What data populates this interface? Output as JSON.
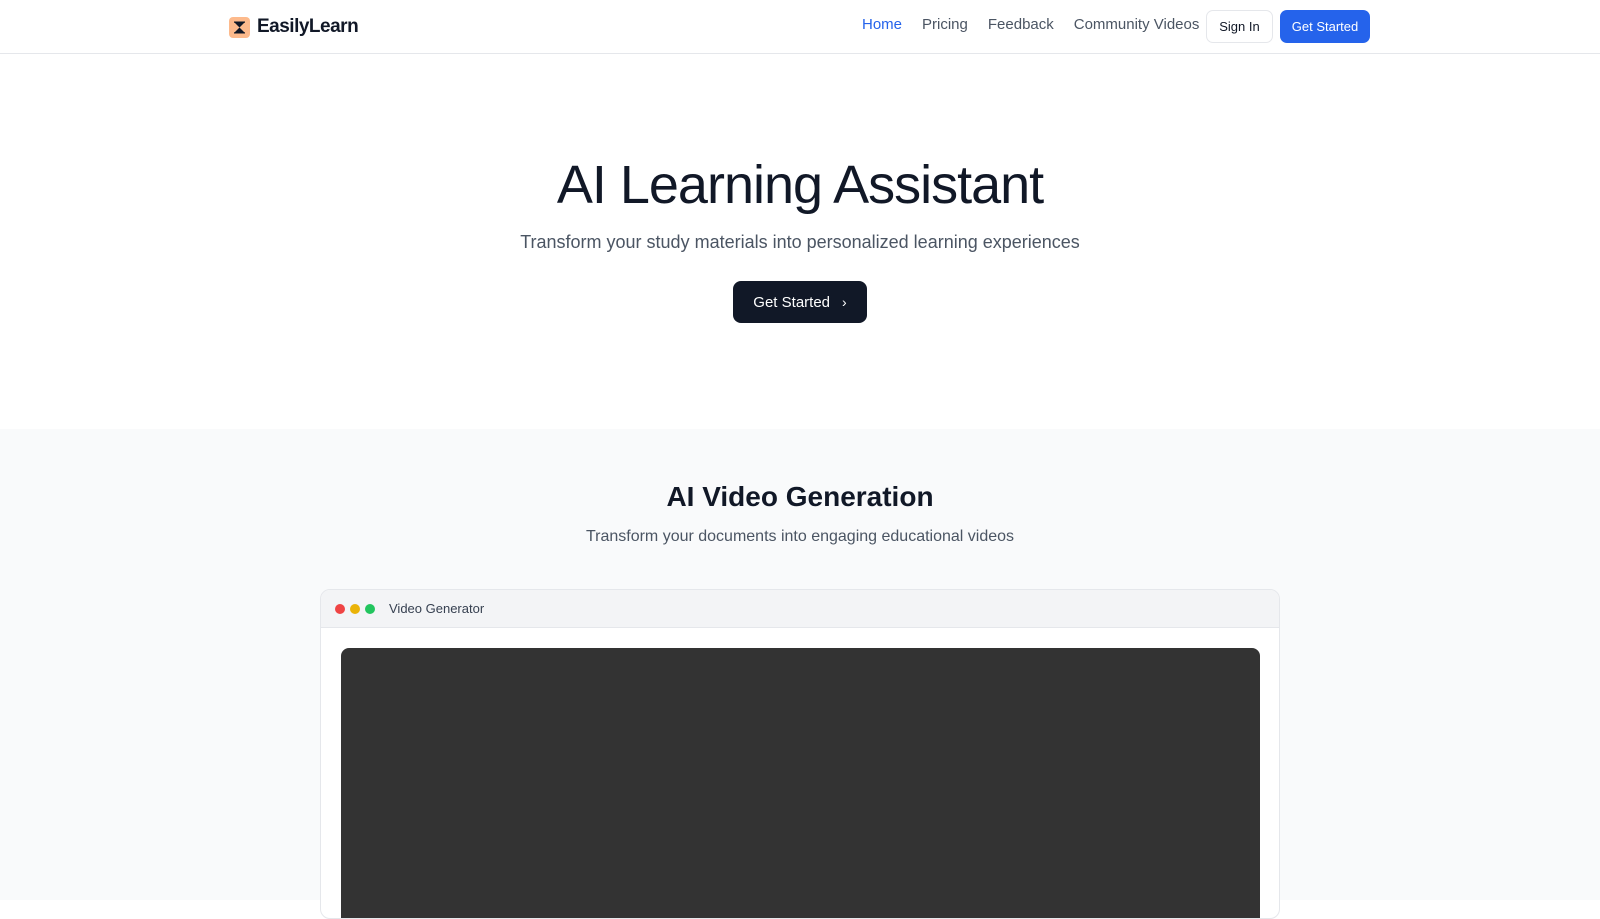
{
  "header": {
    "brand": "EasilyLearn",
    "nav": [
      {
        "label": "Home",
        "active": true
      },
      {
        "label": "Pricing",
        "active": false
      },
      {
        "label": "Feedback",
        "active": false
      },
      {
        "label": "Community Videos",
        "active": false
      }
    ],
    "signin_label": "Sign In",
    "getstarted_label": "Get Started",
    "logo_icon": "hourglass-icon"
  },
  "hero": {
    "title": "AI Learning Assistant",
    "subtitle": "Transform your study materials into personalized learning experiences",
    "cta_label": "Get Started",
    "cta_icon": "chevron-right-icon"
  },
  "feature": {
    "title": "AI Video Generation",
    "subtitle": "Transform your documents into engaging educational videos",
    "window_title": "Video Generator"
  },
  "colors": {
    "accent": "#2563eb",
    "dark": "#111827",
    "logo_bg": "#fdba8c",
    "video_bg": "#333333"
  }
}
